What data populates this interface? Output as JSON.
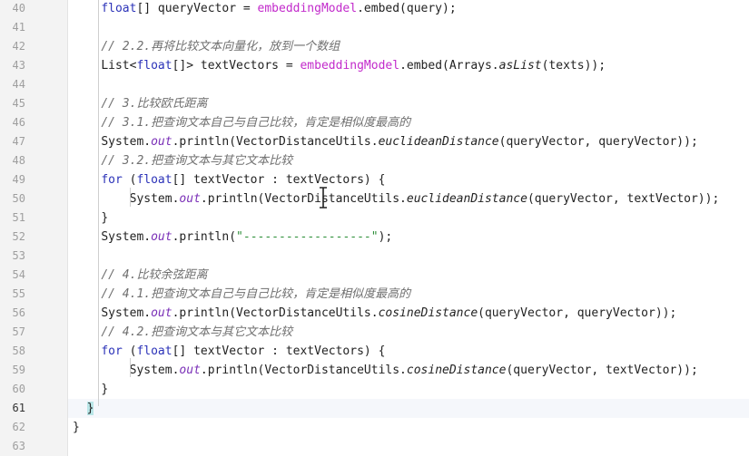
{
  "lines": [
    {
      "n": "40",
      "indent": "    ",
      "tokens": [
        {
          "t": "float",
          "c": "kw"
        },
        {
          "t": "[] queryVector = "
        },
        {
          "t": "embeddingModel",
          "c": "fn"
        },
        {
          "t": ".embed(query);"
        }
      ]
    },
    {
      "n": "41",
      "indent": "",
      "tokens": []
    },
    {
      "n": "42",
      "indent": "    ",
      "tokens": [
        {
          "t": "// 2.2.再将比较文本向量化，放到一个数组",
          "c": "cm"
        }
      ]
    },
    {
      "n": "43",
      "indent": "    ",
      "tokens": [
        {
          "t": "List<"
        },
        {
          "t": "float",
          "c": "kw"
        },
        {
          "t": "[]> textVectors = "
        },
        {
          "t": "embeddingModel",
          "c": "fn"
        },
        {
          "t": ".embed(Arrays."
        },
        {
          "t": "asList",
          "c": "it"
        },
        {
          "t": "(texts));"
        }
      ]
    },
    {
      "n": "44",
      "indent": "",
      "tokens": []
    },
    {
      "n": "45",
      "indent": "    ",
      "tokens": [
        {
          "t": "// 3.比较欧氏距离",
          "c": "cm"
        }
      ]
    },
    {
      "n": "46",
      "indent": "    ",
      "tokens": [
        {
          "t": "// 3.1.把查询文本自己与自己比较，肯定是相似度最高的",
          "c": "cm"
        }
      ]
    },
    {
      "n": "47",
      "indent": "    ",
      "tokens": [
        {
          "t": "System."
        },
        {
          "t": "out",
          "c": "out"
        },
        {
          "t": ".println(VectorDistanceUtils."
        },
        {
          "t": "euclideanDistance",
          "c": "it"
        },
        {
          "t": "(queryVector, queryVector));"
        }
      ]
    },
    {
      "n": "48",
      "indent": "    ",
      "tokens": [
        {
          "t": "// 3.2.把查询文本与其它文本比较",
          "c": "cm"
        }
      ]
    },
    {
      "n": "49",
      "indent": "    ",
      "tokens": [
        {
          "t": "for",
          "c": "kw"
        },
        {
          "t": " ("
        },
        {
          "t": "float",
          "c": "kw"
        },
        {
          "t": "[] textVector : textVectors) {"
        }
      ]
    },
    {
      "n": "50",
      "indent": "        ",
      "tokens": [
        {
          "t": "System."
        },
        {
          "t": "out",
          "c": "out"
        },
        {
          "t": ".println(VectorDistanceUtils."
        },
        {
          "t": "euclideanDistance",
          "c": "it"
        },
        {
          "t": "(queryVector, textVector));"
        }
      ]
    },
    {
      "n": "51",
      "indent": "    ",
      "tokens": [
        {
          "t": "}"
        }
      ]
    },
    {
      "n": "52",
      "indent": "    ",
      "tokens": [
        {
          "t": "System."
        },
        {
          "t": "out",
          "c": "out"
        },
        {
          "t": ".println("
        },
        {
          "t": "\"------------------\"",
          "c": "str"
        },
        {
          "t": ");"
        }
      ]
    },
    {
      "n": "53",
      "indent": "",
      "tokens": []
    },
    {
      "n": "54",
      "indent": "    ",
      "tokens": [
        {
          "t": "// 4.比较余弦距离",
          "c": "cm"
        }
      ]
    },
    {
      "n": "55",
      "indent": "    ",
      "tokens": [
        {
          "t": "// 4.1.把查询文本自己与自己比较，肯定是相似度最高的",
          "c": "cm"
        }
      ]
    },
    {
      "n": "56",
      "indent": "    ",
      "tokens": [
        {
          "t": "System."
        },
        {
          "t": "out",
          "c": "out"
        },
        {
          "t": ".println(VectorDistanceUtils."
        },
        {
          "t": "cosineDistance",
          "c": "it"
        },
        {
          "t": "(queryVector, queryVector));"
        }
      ]
    },
    {
      "n": "57",
      "indent": "    ",
      "tokens": [
        {
          "t": "// 4.2.把查询文本与其它文本比较",
          "c": "cm"
        }
      ]
    },
    {
      "n": "58",
      "indent": "    ",
      "tokens": [
        {
          "t": "for",
          "c": "kw"
        },
        {
          "t": " ("
        },
        {
          "t": "float",
          "c": "kw"
        },
        {
          "t": "[] textVector : textVectors) {"
        }
      ]
    },
    {
      "n": "59",
      "indent": "        ",
      "tokens": [
        {
          "t": "System."
        },
        {
          "t": "out",
          "c": "out"
        },
        {
          "t": ".println(VectorDistanceUtils."
        },
        {
          "t": "cosineDistance",
          "c": "it"
        },
        {
          "t": "(queryVector, textVector));"
        }
      ]
    },
    {
      "n": "60",
      "indent": "    ",
      "tokens": [
        {
          "t": "}"
        }
      ]
    },
    {
      "n": "61",
      "indent": "  ",
      "current": true,
      "tokens": [
        {
          "t": "}",
          "c": "brace-hl"
        }
      ]
    },
    {
      "n": "62",
      "indent": "",
      "tokens": [
        {
          "t": "}"
        }
      ]
    },
    {
      "n": "63",
      "indent": "",
      "tokens": []
    }
  ]
}
